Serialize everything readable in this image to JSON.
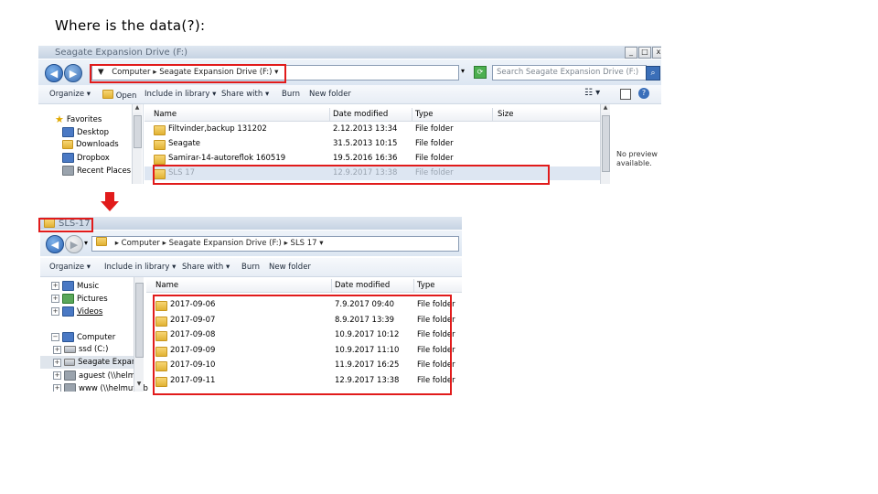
{
  "heading": "Where is the data(?):",
  "colors": {
    "highlight": "#e11b1b",
    "arrow": "#e11b1b"
  },
  "top_window": {
    "title": "Seagate Expansion Drive (F:)",
    "address": [
      "Computer",
      "Seagate Expansion Drive (F:)"
    ],
    "search_placeholder": "Search Seagate Expansion Drive (F:)",
    "commands": [
      "Organize ▾",
      "Open",
      "Include in library ▾",
      "Share with ▾",
      "Burn",
      "New folder"
    ],
    "nav": [
      {
        "label": "Favorites",
        "icon": "star-icon"
      },
      {
        "label": "Desktop",
        "icon": "desktop-icon"
      },
      {
        "label": "Downloads",
        "icon": "downloads-icon"
      },
      {
        "label": "Dropbox",
        "icon": "dropbox-icon"
      },
      {
        "label": "Recent Places",
        "icon": "recent-places-icon"
      }
    ],
    "columns": [
      "Name",
      "Date modified",
      "Type",
      "Size"
    ],
    "rows": [
      {
        "name": "Filtvinder,backup 131202",
        "date": "2.12.2013 13:34",
        "type": "File folder"
      },
      {
        "name": "Seagate",
        "date": "31.5.2013 10:15",
        "type": "File folder"
      },
      {
        "name": "Samirar-14-autoreflok 160519",
        "date": "19.5.2016 16:36",
        "type": "File folder"
      },
      {
        "name": "SLS 17",
        "date": "12.9.2017 13:38",
        "type": "File folder"
      }
    ],
    "preview": "No preview available."
  },
  "bottom_window": {
    "title": "SLS-17",
    "address": [
      "Computer",
      "Seagate Expansion Drive (F:)",
      "SLS 17"
    ],
    "commands": [
      "Organize ▾",
      "Include in library ▾",
      "Share with ▾",
      "Burn",
      "New folder"
    ],
    "nav": [
      {
        "label": "Music",
        "icon": "music-icon"
      },
      {
        "label": "Pictures",
        "icon": "pictures-icon"
      },
      {
        "label": "Videos",
        "icon": "videos-icon"
      },
      {
        "label": "Computer",
        "icon": "computer-icon"
      },
      {
        "label": "ssd (C:)",
        "icon": "drive-icon"
      },
      {
        "label": "Seagate Expansi",
        "icon": "drive-icon"
      },
      {
        "label": "aguest (\\\\helmut",
        "icon": "network-drive-icon"
      },
      {
        "label": "www (\\\\helmut.ab",
        "icon": "network-drive-icon"
      }
    ],
    "columns": [
      "Name",
      "Date modified",
      "Type"
    ],
    "rows": [
      {
        "name": "2017-09-06",
        "date": "7.9.2017 09:40",
        "type": "File folder"
      },
      {
        "name": "2017-09-07",
        "date": "8.9.2017 13:39",
        "type": "File folder"
      },
      {
        "name": "2017-09-08",
        "date": "10.9.2017 10:12",
        "type": "File folder"
      },
      {
        "name": "2017-09-09",
        "date": "10.9.2017 11:10",
        "type": "File folder"
      },
      {
        "name": "2017-09-10",
        "date": "11.9.2017 16:25",
        "type": "File folder"
      },
      {
        "name": "2017-09-11",
        "date": "12.9.2017 13:38",
        "type": "File folder"
      }
    ]
  }
}
